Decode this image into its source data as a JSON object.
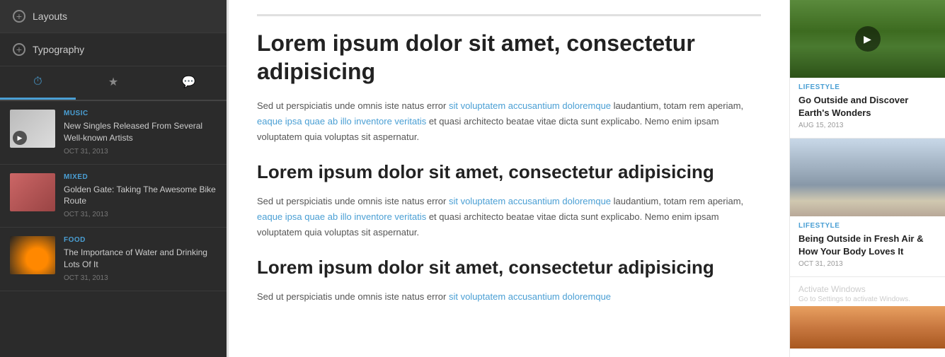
{
  "sidebar": {
    "menu_items": [
      {
        "label": "Layouts",
        "id": "layouts"
      },
      {
        "label": "Typography",
        "id": "typography"
      }
    ],
    "tabs": [
      {
        "label": "⏱",
        "id": "recent",
        "icon": "clock-icon",
        "active": true
      },
      {
        "label": "★",
        "id": "starred",
        "icon": "star-icon",
        "active": false
      },
      {
        "label": "💬",
        "id": "comments",
        "icon": "comment-icon",
        "active": false
      }
    ],
    "articles": [
      {
        "category": "MUSIC",
        "title": "New Singles Released From Several Well-known Artists",
        "date": "OCT 31, 2013",
        "has_play": true,
        "thumb_type": "music"
      },
      {
        "category": "MIXED",
        "title": "Golden Gate: Taking The Awesome Bike Route",
        "date": "OCT 31, 2013",
        "has_play": false,
        "thumb_type": "mixed"
      },
      {
        "category": "FOOD",
        "title": "The Importance of Water and Drinking Lots Of It",
        "date": "OCT 31, 2013",
        "has_play": false,
        "thumb_type": "food"
      }
    ]
  },
  "main": {
    "sections": [
      {
        "heading": "Lorem ipsum dolor sit amet, consectetur adipisicing",
        "heading_level": "h1",
        "body": "Sed ut perspiciatis unde omnis iste natus error sit voluptatem accusantium doloremque laudantium, totam rem aperiam, eaque ipsa quae ab illo inventore veritatis et quasi architecto beatae vitae dicta sunt explicabo. Nemo enim ipsam voluptatem quia voluptas sit aspernatur."
      },
      {
        "heading": "Lorem ipsum dolor sit amet, consectetur adipisicing",
        "heading_level": "h2",
        "body": "Sed ut perspiciatis unde omnis iste natus error sit voluptatem accusantium doloremque laudantium, totam rem aperiam, eaque ipsa quae ab illo inventore veritatis et quasi architecto beatae vitae dicta sunt explicabo. Nemo enim ipsam voluptatem quia voluptas sit aspernatur."
      },
      {
        "heading": "Lorem ipsum dolor sit amet, consectetur adipisicing",
        "heading_level": "h2",
        "body": "Sed ut perspiciatis unde omnis iste natus error sit voluptatem accusantium doloremque"
      }
    ]
  },
  "right_sidebar": {
    "articles": [
      {
        "category": "LIFESTYLE",
        "title": "Go Outside and Discover Earth's Wonders",
        "date": "AUG 15, 2013",
        "has_play": true,
        "thumb_type": "park"
      },
      {
        "category": "LIFESTYLE",
        "title": "Being Outside in Fresh Air & How Your Body Loves It",
        "date": "OCT 31, 2013",
        "has_play": false,
        "thumb_type": "skate"
      }
    ],
    "activate_windows": {
      "title": "Activate Windows",
      "subtitle": "Go to Settings to activate Windows."
    }
  }
}
